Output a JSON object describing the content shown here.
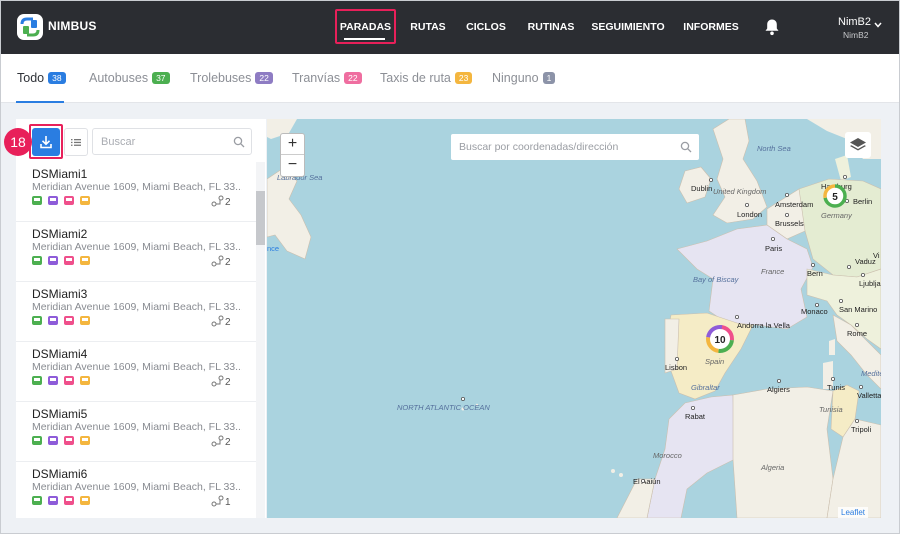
{
  "app": {
    "brand": "NIMBUS"
  },
  "nav": {
    "items": [
      "PARADAS",
      "RUTAS",
      "CICLOS",
      "RUTINAS",
      "SEGUIMIENTO",
      "INFORMES"
    ],
    "active": "PARADAS"
  },
  "user": {
    "name": "NimB2",
    "sub": "NimB2"
  },
  "tabs": [
    {
      "label": "Todo",
      "count": "38",
      "color": "#2a7de1"
    },
    {
      "label": "Autobuses",
      "count": "37",
      "color": "#4caf50"
    },
    {
      "label": "Trolebuses",
      "count": "22",
      "color": "#8e7cc3"
    },
    {
      "label": "Tranvías",
      "count": "22",
      "color": "#ef6ea0"
    },
    {
      "label": "Taxis de ruta",
      "count": "23",
      "color": "#f4b63f"
    },
    {
      "label": "Ninguno",
      "count": "1",
      "color": "#8c93a8"
    }
  ],
  "step_marker": "18",
  "search": {
    "placeholder": "Buscar"
  },
  "stops": [
    {
      "name": "DSMiami1",
      "address": "Meridian Avenue 1609, Miami Beach, FL 33...",
      "routes": "2"
    },
    {
      "name": "DSMiami2",
      "address": "Meridian Avenue 1609, Miami Beach, FL 33...",
      "routes": "2"
    },
    {
      "name": "DSMiami3",
      "address": "Meridian Avenue 1609, Miami Beach, FL 33...",
      "routes": "2"
    },
    {
      "name": "DSMiami4",
      "address": "Meridian Avenue 1609, Miami Beach, FL 33...",
      "routes": "2"
    },
    {
      "name": "DSMiami5",
      "address": "Meridian Avenue 1609, Miami Beach, FL 33...",
      "routes": "2"
    },
    {
      "name": "DSMiami6",
      "address": "Meridian Avenue 1609, Miami Beach, FL 33...",
      "routes": "1"
    }
  ],
  "transport_colors": {
    "bus": "#4caf50",
    "trolleybus": "#8e5cd9",
    "tram": "#ef4f8b",
    "taxi": "#f4b63f"
  },
  "map": {
    "search_placeholder": "Buscar por coordenadas/dirección",
    "zoom_in": "+",
    "zoom_out": "−",
    "attribution": "Leaflet",
    "clusters": [
      {
        "count": "10"
      },
      {
        "count": "5"
      }
    ],
    "labels": {
      "north_sea": "North Sea",
      "labrador_sea": "Labrador Sea",
      "atlantic": "NORTH ATLANTIC OCEAN",
      "bay_of_biscay": "Bay of Biscay",
      "gibraltar": "Gibraltar",
      "mediterranean": "Medite",
      "dublin": "Dublin",
      "uk": "United Kingdom",
      "london": "London",
      "amsterdam": "Amsterdam",
      "hamburg": "Hamburg",
      "berlin": "Berlin",
      "germany": "Germany",
      "brussels": "Brussels",
      "paris": "Paris",
      "france": "France",
      "bern": "Bern",
      "vaduz": "Vaduz",
      "ljubljana": "Ljubljana",
      "monaco": "Monaco",
      "san_marino": "San Marino",
      "rome": "Rome",
      "andorra": "Andorra la Vella",
      "spain": "Spain",
      "lisbon": "Lisbon",
      "algiers": "Algiers",
      "tunis": "Tunis",
      "tunisia": "Tunisia",
      "valletta": "Valletta",
      "tripoli": "Tripoli",
      "rabat": "Rabat",
      "morocco": "Morocco",
      "algeria": "Algeria",
      "el_aaiun": "El Aaiún",
      "france_partial": "nce",
      "vienna_partial": "Vi"
    }
  }
}
